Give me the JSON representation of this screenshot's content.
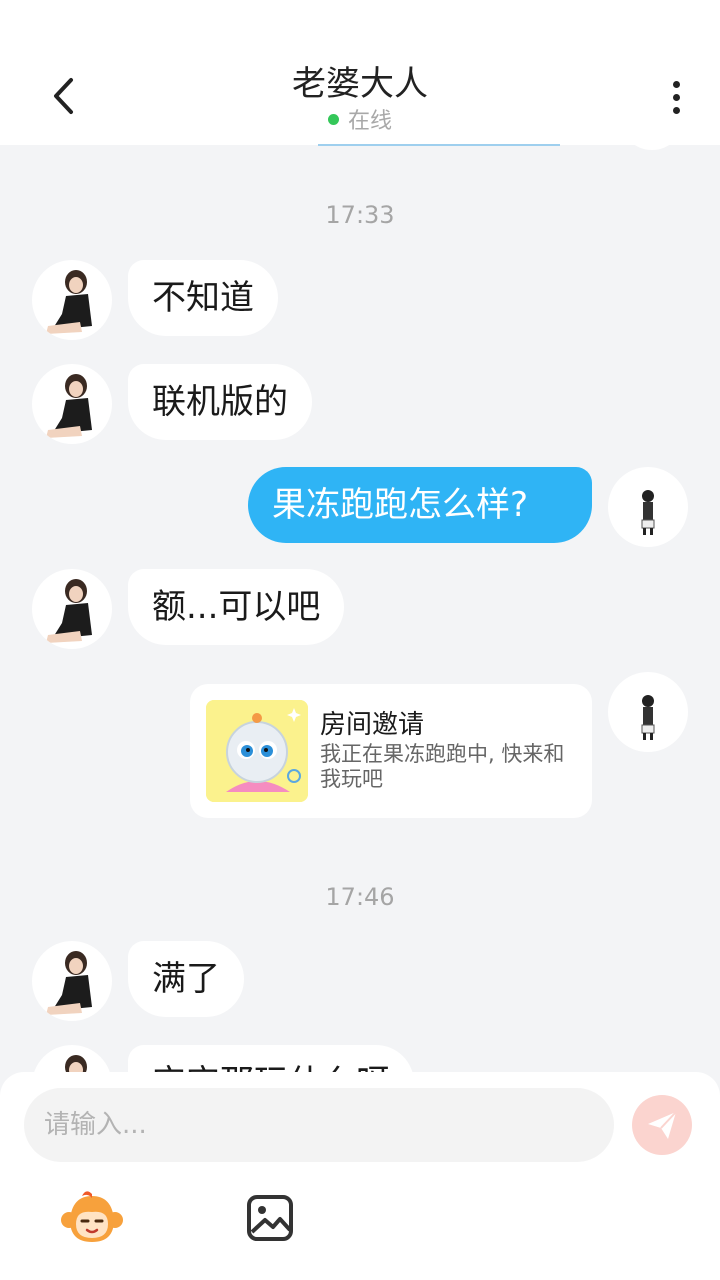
{
  "header": {
    "title": "老婆大人",
    "status": "在线",
    "status_color": "#34c759"
  },
  "messages": [
    {
      "type": "time",
      "text": "17:33"
    },
    {
      "type": "text",
      "from": "contact",
      "text": "不知道"
    },
    {
      "type": "text",
      "from": "contact",
      "text": "联机版的"
    },
    {
      "type": "text",
      "from": "me",
      "text": "果冻跑跑怎么样?"
    },
    {
      "type": "text",
      "from": "contact",
      "text": "额...可以吧"
    },
    {
      "type": "invite_card",
      "from": "me",
      "title": "房间邀请",
      "description": "我正在果冻跑跑中, 快来和我玩吧",
      "thumbnail_icon": "jelly-game-icon"
    },
    {
      "type": "time",
      "text": "17:46"
    },
    {
      "type": "text",
      "from": "contact",
      "text": "满了"
    },
    {
      "type": "text",
      "from": "contact",
      "text": "宝宝那玩什么呀"
    }
  ],
  "composer": {
    "placeholder": "请输入...",
    "send_icon": "paper-plane-icon",
    "tools": [
      "monkey-emoji-icon",
      "image-icon"
    ]
  },
  "colors": {
    "bubble_out": "#2fb4f5",
    "bubble_in": "#ffffff",
    "background": "#f3f4f6",
    "send_button": "#fbd4cf"
  }
}
